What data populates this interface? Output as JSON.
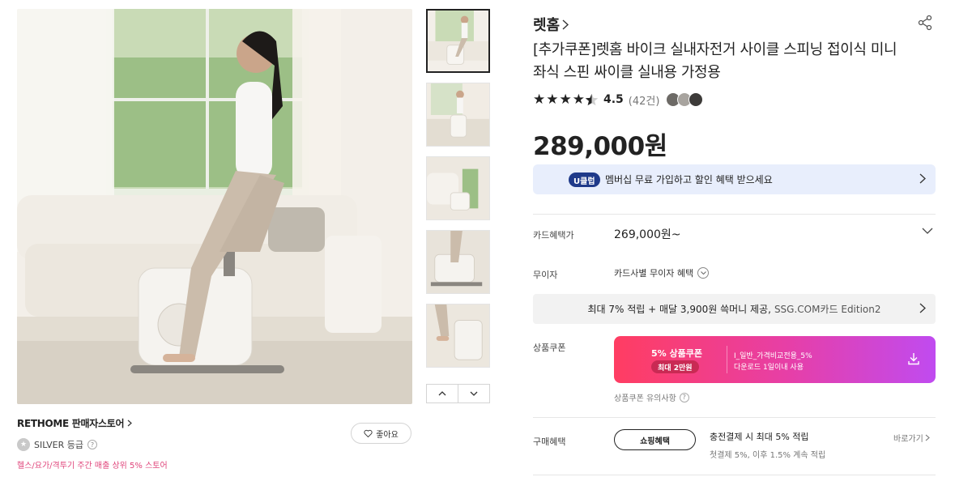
{
  "gallery": {
    "main_image": "exercise-bike-lifestyle-photo",
    "thumbnail_count": 5,
    "nav": {
      "up_icon": "chevron-up-icon",
      "down_icon": "chevron-down-icon"
    }
  },
  "store": {
    "name": "RETHOME 판매자스토어",
    "grade": "SILVER 등급",
    "rank": "헬스/요가/격투기 주간 매출 상위 5% 스토어",
    "like_label": "좋아요"
  },
  "product": {
    "brand": "렛홈",
    "title": "[추가쿠폰]렛홈 바이크 실내자전거 사이클 스피닝 접이식 미니 좌식 스핀 싸이클 실내용 가정용",
    "rating_value": "4.5",
    "rating_stars": 4.5,
    "review_count": "(42건)",
    "price": "289,000원"
  },
  "uclub": {
    "badge": "U클럽",
    "text": "멤버십 무료 가입하고 할인 혜택 받으세요"
  },
  "card_benefit": {
    "label": "카드혜택가",
    "value": "269,000원~"
  },
  "installment": {
    "label": "무이자",
    "value": "카드사별 무이자 혜택"
  },
  "ssg_card": {
    "text": "최대 7% 적립 + 매달 3,900원 쓱머니 제공,",
    "suffix": "SSG.COM카드 Edition2"
  },
  "coupon": {
    "label": "상품쿠폰",
    "title": "5% 상품쿠폰",
    "max": "최대 2만원",
    "desc1": "I_일반_가격비교전용_5%",
    "desc2": "다운로드 1일이내 사용",
    "note": "상품쿠폰 유의사항"
  },
  "purchase_benefit": {
    "label": "구매혜택",
    "button": "쇼핑혜택",
    "line1": "충전결제 시 최대 5% 적립",
    "line2": "첫결제 5%, 이후 1.5% 계속 적립",
    "shortcut": "바로가기"
  },
  "colors": {
    "uclub_bg": "#e8eefc",
    "uclub_badge": "#1f3a8a",
    "coupon_start": "#ff3d62",
    "coupon_end": "#c04bf0",
    "rank_text": "#e0457b"
  }
}
